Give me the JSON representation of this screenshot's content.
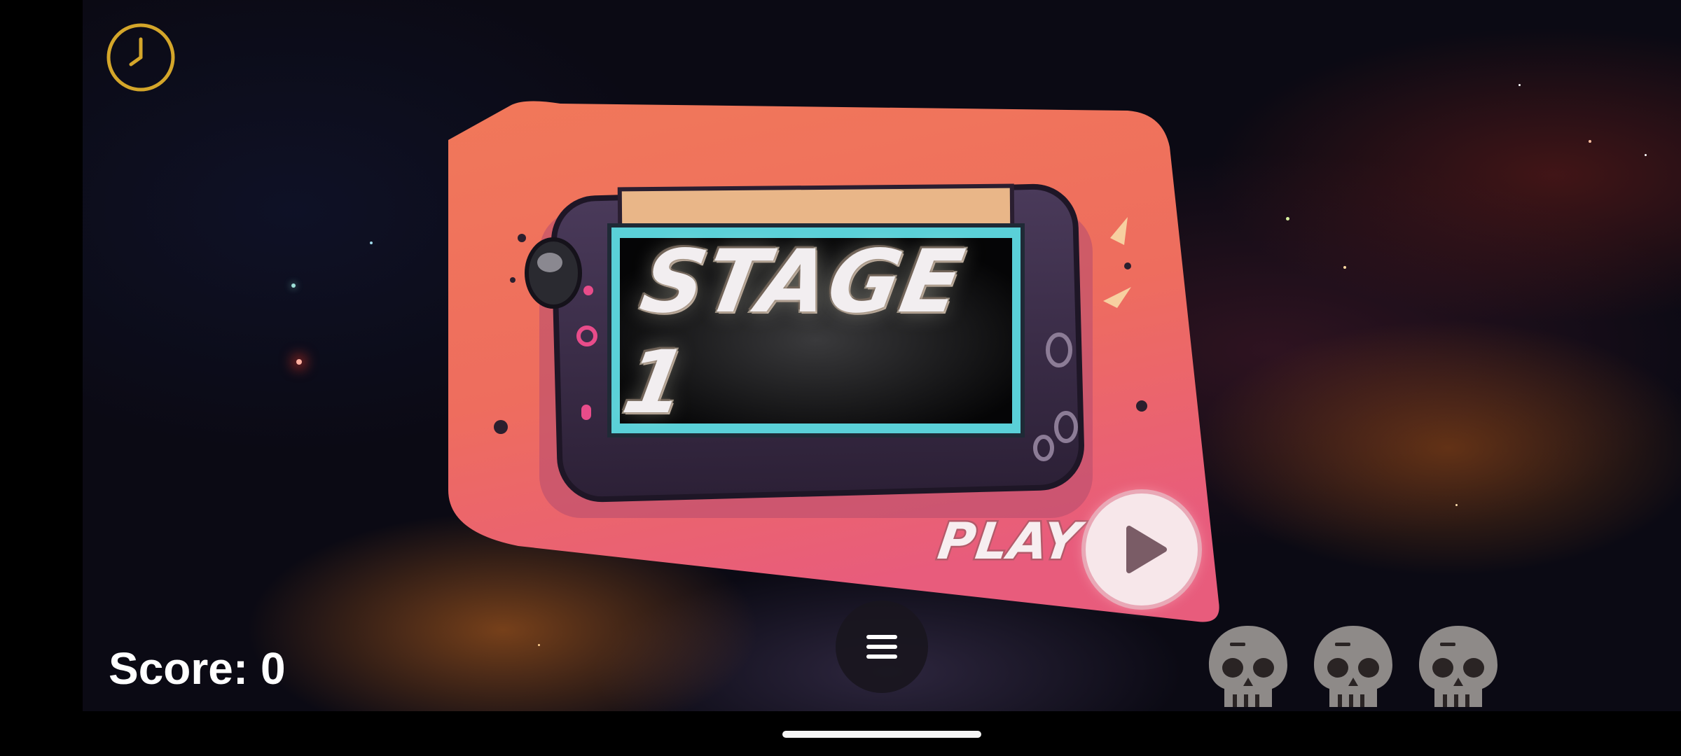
{
  "stage": {
    "title": "STAGE 1"
  },
  "play_button": {
    "label": "PLAY",
    "icon": "play-icon"
  },
  "hud": {
    "score_label": "Score: 0",
    "lives_remaining": 3,
    "life_icon": "skull-icon",
    "timer_icon": "clock-icon",
    "menu_icon": "hamburger-menu-icon"
  },
  "colors": {
    "timer_gold": "#d4a62a",
    "card_coral": "#f0735a",
    "card_pink": "#e85d7e",
    "screen_cyan": "#5ad0d8",
    "handheld_purple": "#3a2a48",
    "skull_grey": "#8e8a88"
  }
}
